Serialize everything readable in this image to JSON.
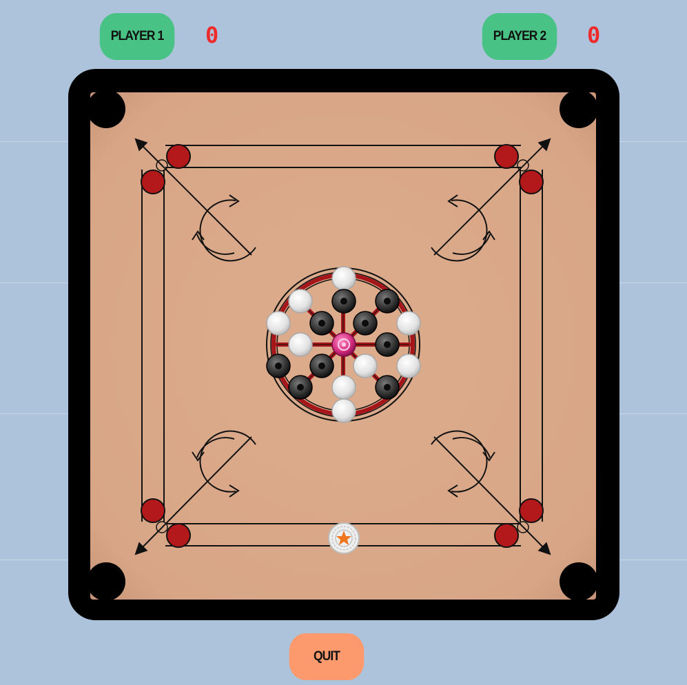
{
  "players": [
    {
      "label": "PLAYER 1",
      "score": "0"
    },
    {
      "label": "PLAYER 2",
      "score": "0"
    }
  ],
  "quit_label": "QUIT",
  "colors": {
    "background": "#adc3db",
    "frame": "#000000",
    "board": "#d9a888",
    "player_button": "#48c285",
    "quit_button": "#fc9a6e",
    "score": "#ef2a2a",
    "red_marker": "#b3191a",
    "queen": "#d12c7f"
  },
  "pieces": {
    "queen": 1,
    "white": 9,
    "black": 9,
    "striker": 1
  }
}
